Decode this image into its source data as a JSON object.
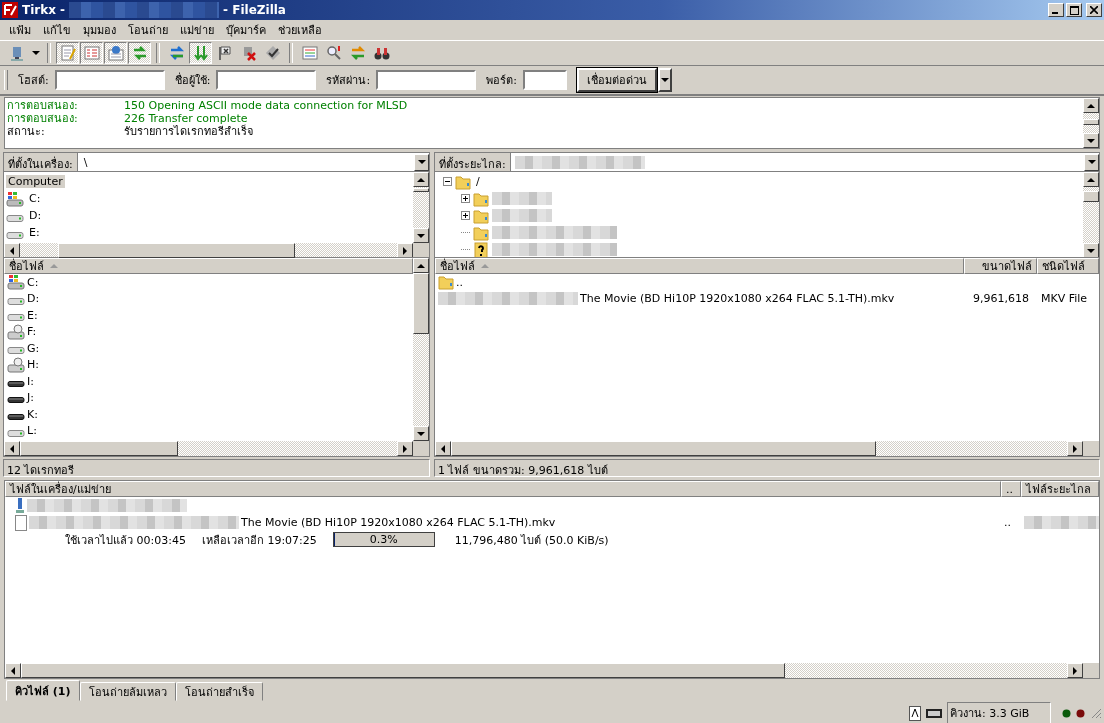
{
  "window": {
    "title_prefix": "Tirkx -",
    "title_suffix": "- FileZilla"
  },
  "menu": [
    "แฟ้ม",
    "แก้ไข",
    "มุมมอง",
    "โอนถ่าย",
    "แม่ข่าย",
    "บุ๊คมาร์ค",
    "ช่วยเหลือ"
  ],
  "toolbar": [
    {
      "pressed": false
    },
    {
      "pressed": true
    },
    {
      "pressed": true
    },
    {
      "pressed": true
    },
    {
      "pressed": true
    },
    {
      "pressed": false
    },
    {
      "pressed": true
    },
    {
      "pressed": false
    },
    {
      "pressed": false
    },
    {
      "pressed": false
    },
    {
      "pressed": false
    },
    {
      "pressed": false
    },
    {
      "pressed": false
    },
    {
      "pressed": false
    }
  ],
  "quickconnect": {
    "host_label": "โฮสต์:",
    "user_label": "ชื่อผู้ใช้:",
    "password_label": "รหัสผ่าน:",
    "port_label": "พอร์ต:",
    "button": "เชื่อมต่อด่วน"
  },
  "log": [
    {
      "kind": "response",
      "label": "การตอบสนอง:",
      "message": "150 Opening ASCII mode data connection for MLSD"
    },
    {
      "kind": "response",
      "label": "การตอบสนอง:",
      "message": "226 Transfer complete"
    },
    {
      "kind": "status",
      "label": "สถานะ:",
      "message": "รับรายการไดเรกทอรีสำเร็จ"
    }
  ],
  "local": {
    "site_label": "ที่ตั้งในเครื่อง:",
    "path": "\\",
    "tree": [
      {
        "label": "Computer",
        "selected": true,
        "children": [
          {
            "label": "C:",
            "kind": "system"
          },
          {
            "label": "D:",
            "kind": "drive"
          },
          {
            "label": "E:",
            "kind": "drive"
          }
        ]
      }
    ],
    "columns": [
      "ชื่อไฟล์"
    ],
    "files": [
      {
        "label": "C:",
        "kind": "system"
      },
      {
        "label": "D:",
        "kind": "drive"
      },
      {
        "label": "E:",
        "kind": "drive"
      },
      {
        "label": "F:",
        "kind": "network"
      },
      {
        "label": "G:",
        "kind": "drive"
      },
      {
        "label": "H:",
        "kind": "network"
      },
      {
        "label": "I:",
        "kind": "removable"
      },
      {
        "label": "J:",
        "kind": "removable"
      },
      {
        "label": "K:",
        "kind": "removable"
      },
      {
        "label": "L:",
        "kind": "drive"
      }
    ],
    "status": "12 ไดเรกทอรี"
  },
  "remote": {
    "site_label": "ที่ตั้งระยะไกล:",
    "tree": [
      {
        "label": "/",
        "expanded": true,
        "children": [
          {
            "kind": "folder",
            "expandable": true
          },
          {
            "kind": "folder",
            "expandable": true
          },
          {
            "kind": "folder",
            "expandable": false
          },
          {
            "kind": "unknown",
            "expandable": false
          }
        ]
      }
    ],
    "columns": [
      "ชื่อไฟล์",
      "ขนาดไฟล์",
      "ชนิดไฟล์"
    ],
    "files": [
      {
        "kind": "parent",
        "name": ".."
      },
      {
        "kind": "file",
        "name": "The Movie (BD Hi10P 1920x1080 x264 FLAC 5.1-TH).mkv",
        "size": "9,961,618",
        "type": "MKV File"
      }
    ],
    "status": "1 ไฟล์ ขนาดรวม: 9,961,618 ไบต์"
  },
  "queue": {
    "columns": [
      "ไฟล์ในเครื่อง/แม่ข่าย",
      "..",
      "ไฟล์ระยะไกล"
    ],
    "file": {
      "local": "The Movie (BD Hi10P 1920x1080 x264 FLAC 5.1-TH).mkv",
      "direction": ".."
    },
    "elapsed": "ใช้เวลาไปแล้ว 00:03:45",
    "remaining": "เหลือเวลาอีก 19:07:25",
    "progress": {
      "level": 0.003,
      "text": "0.3%"
    },
    "transferred": "11,796,480 ไบต์ (50.0 KiB/s)"
  },
  "tabs": [
    {
      "label": "คิวไฟล์ (1)",
      "selected": true
    },
    {
      "label": "โอนถ่ายล้มเหลว",
      "selected": false
    },
    {
      "label": "โอนถ่ายสำเร็จ",
      "selected": false
    }
  ],
  "status_bar": {
    "queue": "คิวงาน: 3.3 GiB"
  }
}
